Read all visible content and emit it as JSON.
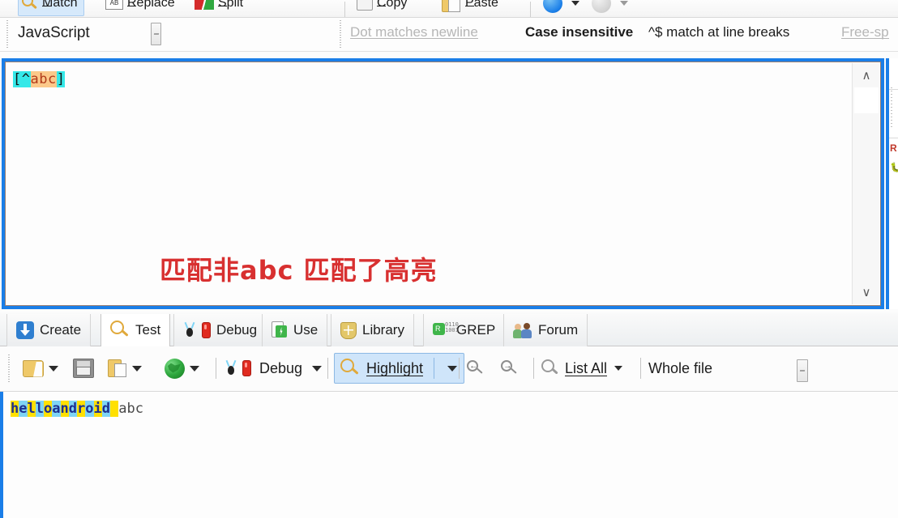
{
  "app": {
    "title": "RegexBuddy"
  },
  "top_toolbar": {
    "items": [
      {
        "label": "Match",
        "icon": "magnifier-icon",
        "selected": true
      },
      {
        "label": "Replace",
        "icon": "replace-icon",
        "selected": false
      },
      {
        "label": "Split",
        "icon": "split-icon",
        "selected": false
      },
      {
        "label": "Copy",
        "icon": "copy-icon",
        "selected": false
      },
      {
        "label": "Paste",
        "icon": "paste-icon",
        "selected": false
      }
    ]
  },
  "options_bar": {
    "flavor": "JavaScript",
    "options": [
      {
        "label": "Dot matches newline",
        "enabled": false
      },
      {
        "label": "Case insensitive",
        "enabled": true
      },
      {
        "label": "^$ match at line breaks",
        "enabled": true
      },
      {
        "label": "Free-sp",
        "enabled": false
      }
    ]
  },
  "regex_editor": {
    "tokens": [
      {
        "text": "[",
        "style": "bracket"
      },
      {
        "text": "^",
        "style": "bracket"
      },
      {
        "text": "abc",
        "style": "class"
      },
      {
        "text": "]",
        "style": "bracket"
      }
    ],
    "full_text": "[^abc]",
    "annotation": "匹配非abc  匹配了高亮",
    "annotation_color": "#d83030",
    "focus_color": "#1a7ee8",
    "scroll_up": "∧",
    "scroll_down": "∨"
  },
  "tabs": [
    {
      "label": "Create",
      "icon": "create-icon",
      "active": false
    },
    {
      "label": "Test",
      "icon": "magnifier-icon",
      "active": true
    },
    {
      "label": "Debug",
      "icon": "bug-icon",
      "active": false
    },
    {
      "label": "Use",
      "icon": "use-icon",
      "active": false
    },
    {
      "label": "Library",
      "icon": "library-icon",
      "active": false
    },
    {
      "label": "GREP",
      "icon": "grep-icon",
      "active": false
    },
    {
      "label": "Forum",
      "icon": "forum-icon",
      "active": false
    }
  ],
  "action_bar": {
    "open_icon": "open-folder-icon",
    "save_icon": "save-disk-icon",
    "paste_icon": "paste-clipboard-icon",
    "globe_icon": "globe-icon",
    "debug_label": "Debug",
    "debug_icon": "bug-icon",
    "highlight_label": "Highlight",
    "highlight_icon": "magnifier-icon",
    "highlight_active": true,
    "find_prev_icon": "find-previous-icon",
    "find_next_icon": "find-next-icon",
    "list_all_label": "List All",
    "list_all_icon": "magnifier-icon",
    "scope_label": "Whole file"
  },
  "subject": {
    "segments": [
      {
        "text": "h",
        "hl": "a"
      },
      {
        "text": "e",
        "hl": "b"
      },
      {
        "text": "l",
        "hl": "a"
      },
      {
        "text": "l",
        "hl": "b"
      },
      {
        "text": "o",
        "hl": "a"
      },
      {
        "text": "a",
        "hl": "b"
      },
      {
        "text": "n",
        "hl": "a"
      },
      {
        "text": "d",
        "hl": "b"
      },
      {
        "text": "r",
        "hl": "a"
      },
      {
        "text": "o",
        "hl": "b"
      },
      {
        "text": "i",
        "hl": "a"
      },
      {
        "text": "d",
        "hl": "b"
      },
      {
        "text": " ",
        "hl": "a"
      },
      {
        "text": "abc",
        "hl": "none"
      }
    ],
    "plain_text": "helloandroid abc",
    "highlight_color_a": "#ffe000",
    "highlight_color_b": "#7fd4f5"
  }
}
